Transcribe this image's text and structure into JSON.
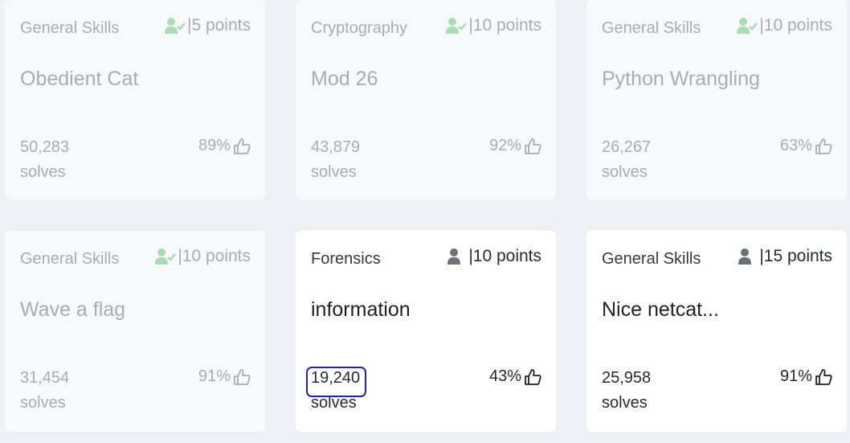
{
  "cards": [
    {
      "category": "General Skills",
      "points": "|5 points",
      "title": "Obedient Cat",
      "solves": "50,283",
      "solves_label": "solves",
      "rating": "89%",
      "solved": true
    },
    {
      "category": "Cryptography",
      "points": "|10 points",
      "title": "Mod 26",
      "solves": "43,879",
      "solves_label": "solves",
      "rating": "92%",
      "solved": true
    },
    {
      "category": "General Skills",
      "points": "|10 points",
      "title": "Python Wrangling",
      "solves": "26,267",
      "solves_label": "solves",
      "rating": "63%",
      "solved": true
    },
    {
      "category": "General Skills",
      "points": "|10 points",
      "title": "Wave a flag",
      "solves": "31,454",
      "solves_label": "solves",
      "rating": "91%",
      "solved": true
    },
    {
      "category": "Forensics",
      "points": "|10 points",
      "title": "information",
      "solves": "19,240",
      "solves_label": "solves",
      "rating": "43%",
      "solved": false
    },
    {
      "category": "General Skills",
      "points": "|15 points",
      "title": "Nice netcat...",
      "solves": "25,958",
      "solves_label": "solves",
      "rating": "91%",
      "solved": false
    }
  ],
  "colors": {
    "solved_icon": "#a8dcb4",
    "unsolved_icon": "#6c7178",
    "highlight_annotation": "#1a1fc8"
  },
  "icons": {
    "solved": "user-check-icon",
    "unsolved": "user-icon",
    "rating": "thumbs-up-icon"
  }
}
